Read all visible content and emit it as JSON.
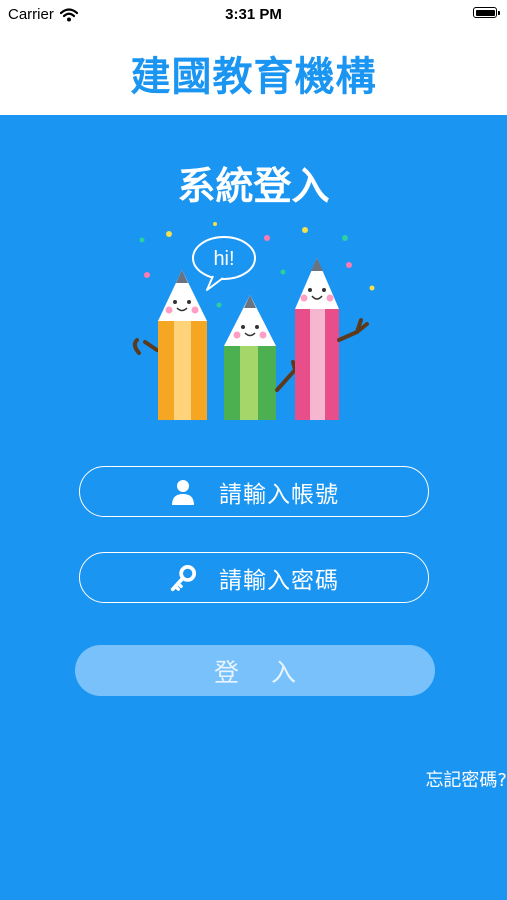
{
  "status_bar": {
    "carrier": "Carrier",
    "time": "3:31 PM"
  },
  "header": {
    "title": "建國教育機構"
  },
  "login": {
    "heading": "系統登入",
    "account_placeholder": "請輸入帳號",
    "password_placeholder": "請輸入密碼",
    "submit_label": "登入",
    "forgot_password": "忘記密碼?"
  },
  "illustration": {
    "speech_bubble": "hi!"
  },
  "colors": {
    "primary": "#1b95f2",
    "button_disabled": "#78c1fb",
    "header_bg": "#ffffff"
  }
}
